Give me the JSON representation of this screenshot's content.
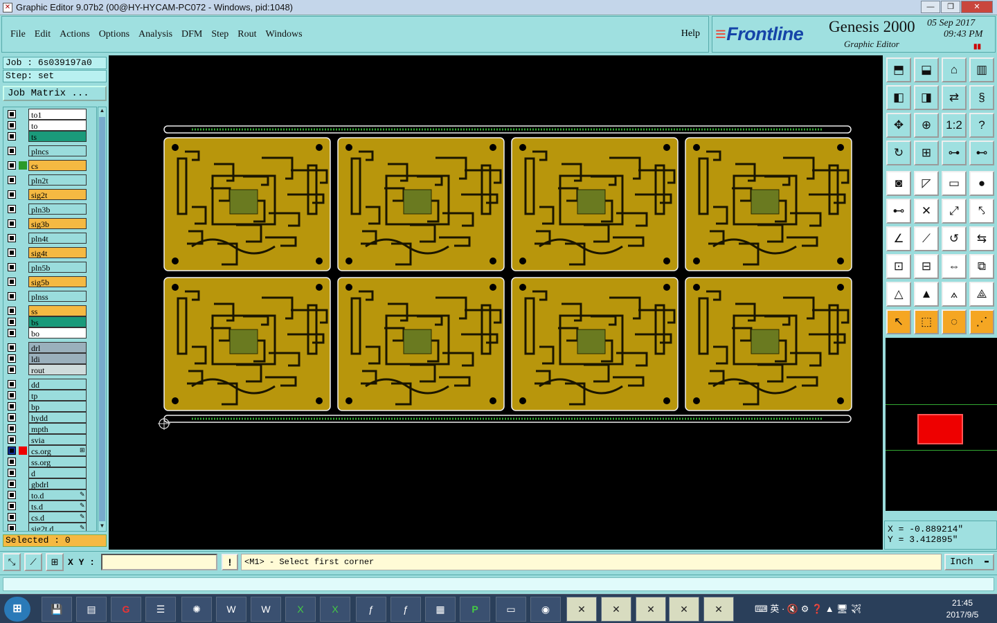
{
  "titlebar": {
    "title": "Graphic Editor 9.07b2 (00@HY-HYCAM-PC072 - Windows, pid:1048)",
    "min": "—",
    "max": "❐",
    "close": "✕"
  },
  "menu": [
    "File",
    "Edit",
    "Actions",
    "Options",
    "Analysis",
    "DFM",
    "Step",
    "Rout",
    "Windows"
  ],
  "help": "Help",
  "brand": {
    "logo": "Frontline",
    "product": "Genesis 2000",
    "subtitle": "Graphic Editor",
    "date": "05  Sep  2017",
    "time": "09:43  PM"
  },
  "job": {
    "label": "Job :",
    "name": "6s039197a0",
    "step_label": "Step:",
    "step": "set",
    "matrix_button": "Job Matrix ..."
  },
  "layers": [
    {
      "name": "to1",
      "color": "#ffffff"
    },
    {
      "name": "to",
      "color": "#ffffff"
    },
    {
      "name": "ts",
      "color": "#1a9a7a"
    },
    {
      "name": "plncs",
      "color": "#9adcdc",
      "gap": true
    },
    {
      "name": "cs",
      "color": "#f5b942",
      "gap": true,
      "swatch": "#2a9a2a"
    },
    {
      "name": "pln2t",
      "color": "#9adcdc",
      "gap": true
    },
    {
      "name": "sig2t",
      "color": "#f5b942",
      "gap": true
    },
    {
      "name": "pln3b",
      "color": "#9adcdc",
      "gap": true
    },
    {
      "name": "sig3b",
      "color": "#f5b942",
      "gap": true
    },
    {
      "name": "pln4t",
      "color": "#9adcdc",
      "gap": true
    },
    {
      "name": "sig4t",
      "color": "#f5b942",
      "gap": true
    },
    {
      "name": "pln5b",
      "color": "#9adcdc",
      "gap": true
    },
    {
      "name": "sig5b",
      "color": "#f5b942",
      "gap": true
    },
    {
      "name": "plnss",
      "color": "#9adcdc",
      "gap": true
    },
    {
      "name": "ss",
      "color": "#f5b942",
      "gap": true
    },
    {
      "name": "bs",
      "color": "#1a9a7a"
    },
    {
      "name": "bo",
      "color": "#ffffff"
    },
    {
      "name": "drl",
      "color": "#9ab0bc",
      "gap": true
    },
    {
      "name": "ldi",
      "color": "#9ab0bc"
    },
    {
      "name": "rout",
      "color": "#cfdcdc"
    },
    {
      "name": "dd",
      "color": "#9adcdc",
      "gap": true
    },
    {
      "name": "tp",
      "color": "#9adcdc"
    },
    {
      "name": "bp",
      "color": "#9adcdc"
    },
    {
      "name": "hydd",
      "color": "#9adcdc"
    },
    {
      "name": "mpth",
      "color": "#9adcdc"
    },
    {
      "name": "svia",
      "color": "#9adcdc"
    },
    {
      "name": "cs.org",
      "color": "#9adcdc",
      "swatch": "#e00",
      "ind": "⊞",
      "active": true
    },
    {
      "name": "ss.org",
      "color": "#9adcdc"
    },
    {
      "name": "d",
      "color": "#9adcdc"
    },
    {
      "name": "gbdrl",
      "color": "#9adcdc"
    },
    {
      "name": "to.d",
      "color": "#9adcdc",
      "ind": "✎"
    },
    {
      "name": "ts.d",
      "color": "#9adcdc",
      "ind": "✎"
    },
    {
      "name": "cs.d",
      "color": "#9adcdc",
      "ind": "✎"
    },
    {
      "name": "sig2t.d",
      "color": "#9adcdc",
      "ind": "✎"
    }
  ],
  "selected": "Selected : 0",
  "coords": {
    "x": "X = -0.889214\"",
    "y": "Y = 3.412895\""
  },
  "status": {
    "xy_label": "X Y :",
    "xy_value": "",
    "bang": "!",
    "prompt": "<M1> - Select first corner",
    "unit": "Inch"
  },
  "taskbar": {
    "time": "21:45",
    "date": "2017/9/5",
    "tray": "⌨ 英 · 🔇 ⚙ ❓ ▲  🖥 ✈"
  }
}
